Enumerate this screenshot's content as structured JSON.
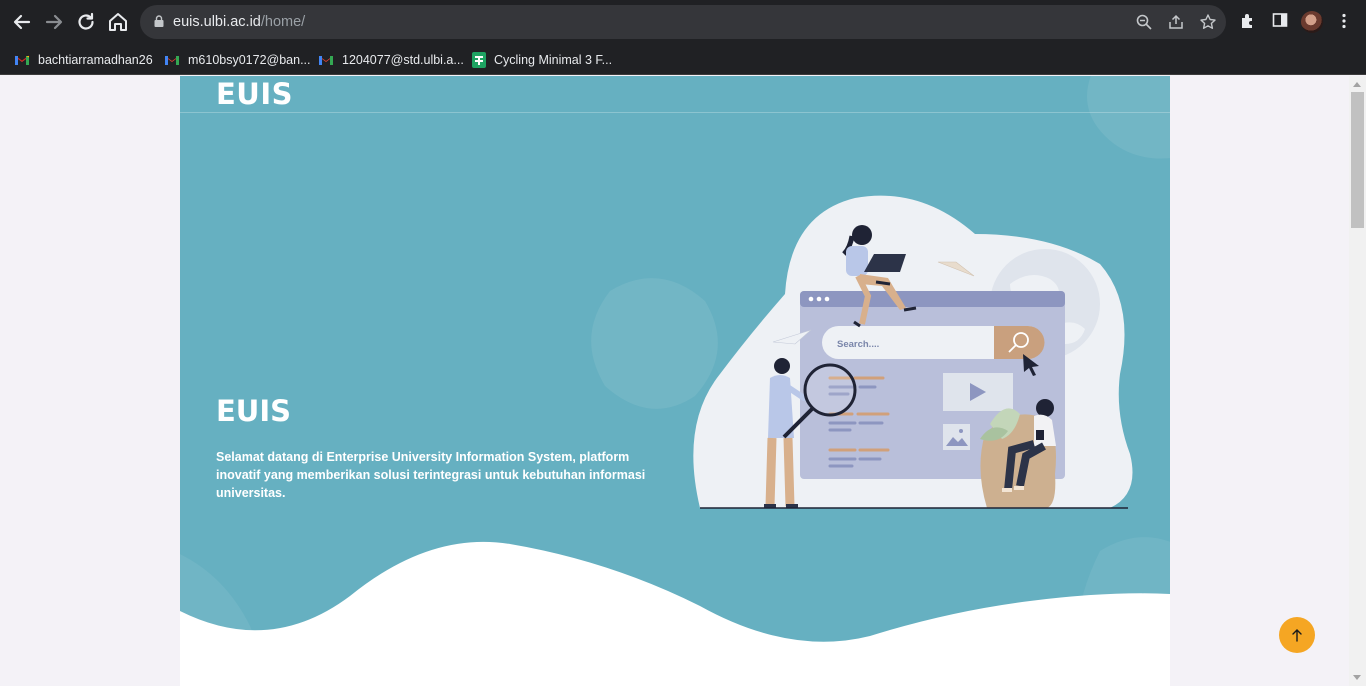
{
  "browser": {
    "url_host": "euis.ulbi.ac.id",
    "url_path": "/home/",
    "nav": {
      "back_icon": "arrow-left-icon",
      "forward_icon": "arrow-right-icon",
      "reload_icon": "reload-icon",
      "home_icon": "home-icon"
    },
    "bookmarks": [
      {
        "label": "bachtiarramadhan26",
        "icon": "gmail-icon"
      },
      {
        "label": "m610bsy0172@ban...",
        "icon": "gmail-icon"
      },
      {
        "label": "1204077@std.ulbi.a...",
        "icon": "gmail-icon"
      },
      {
        "label": "Cycling Minimal 3 F...",
        "icon": "sheets-icon"
      }
    ]
  },
  "page": {
    "logo": "EUIS",
    "hero_title": "EUIS",
    "hero_description": "Selamat datang di Enterprise University Information System, platform inovatif yang memberikan solusi terintegrasi untuk kebutuhan informasi universitas.",
    "illustration": {
      "search_placeholder": "Search...."
    },
    "back_to_top_icon": "arrow-up-icon"
  },
  "colors": {
    "hero_bg": "#66b0c1",
    "accent": "#f5a623"
  }
}
